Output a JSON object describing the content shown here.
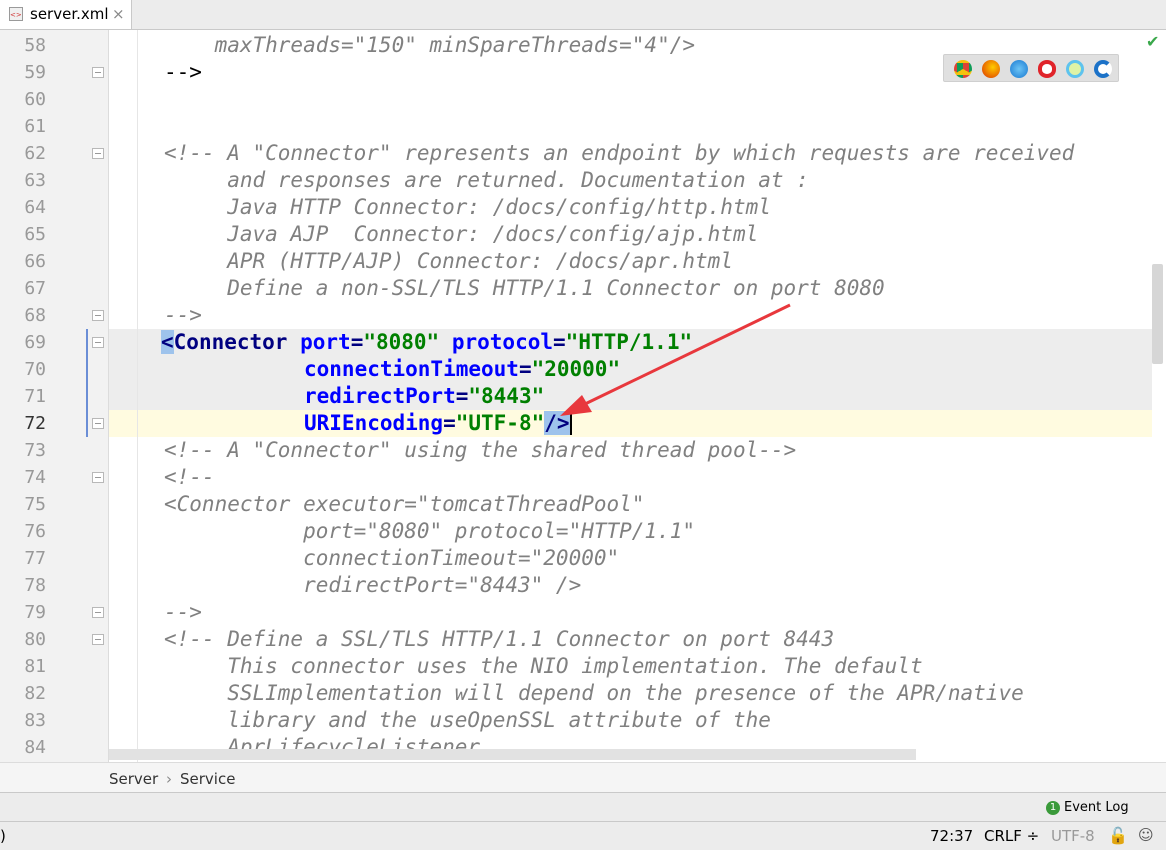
{
  "tab": {
    "filename": "server.xml",
    "close_glyph": "×"
  },
  "gutter": {
    "line_numbers": [
      "58",
      "59",
      "60",
      "61",
      "62",
      "63",
      "64",
      "65",
      "66",
      "67",
      "68",
      "69",
      "70",
      "71",
      "72",
      "73",
      "74",
      "75",
      "76",
      "77",
      "78",
      "79",
      "80",
      "81",
      "82",
      "83",
      "84"
    ]
  },
  "code": {
    "l58": "    maxThreads=\"150\" minSpareThreads=\"4\"/>",
    "l59": "-->",
    "l62": "<!-- A \"Connector\" represents an endpoint by which requests are received",
    "l63": "     and responses are returned. Documentation at :",
    "l64": "     Java HTTP Connector: /docs/config/http.html",
    "l65": "     Java AJP  Connector: /docs/config/ajp.html",
    "l66": "     APR (HTTP/AJP) Connector: /docs/apr.html",
    "l67": "     Define a non-SSL/TLS HTTP/1.1 Connector on port 8080",
    "l68": "-->",
    "l69": {
      "open": "<",
      "tag": "Connector",
      "a1": "port",
      "v1": "\"8080\"",
      "a2": "protocol",
      "v2": "\"HTTP/1.1\""
    },
    "l70": {
      "attr": "connectionTimeout",
      "val": "\"20000\""
    },
    "l71": {
      "attr": "redirectPort",
      "val": "\"8443\""
    },
    "l72": {
      "attr": "URIEncoding",
      "val": "\"UTF-8\"",
      "close": "/>"
    },
    "l73": "<!-- A \"Connector\" using the shared thread pool-->",
    "l74": "<!--",
    "l75": "<Connector executor=\"tomcatThreadPool\"",
    "l76": "           port=\"8080\" protocol=\"HTTP/1.1\"",
    "l77": "           connectionTimeout=\"20000\"",
    "l78": "           redirectPort=\"8443\" />",
    "l79": "-->",
    "l80": "<!-- Define a SSL/TLS HTTP/1.1 Connector on port 8443",
    "l81": "     This connector uses the NIO implementation. The default",
    "l82": "     SSLImplementation will depend on the presence of the APR/native",
    "l83": "     library and the useOpenSSL attribute of the",
    "l84": "     AprLifecycleListener."
  },
  "browser_icons": [
    "chrome-icon",
    "firefox-icon",
    "safari-icon",
    "opera-icon",
    "ie-icon",
    "edge-icon"
  ],
  "breadcrumbs": {
    "item1": "Server",
    "separator": "›",
    "item2": "Service"
  },
  "event_log": {
    "badge": "1",
    "label": "Event Log"
  },
  "status": {
    "left": ")",
    "position": "72:37",
    "line_sep": "CRLF ÷",
    "encoding": "UTF-8"
  },
  "colors": {
    "tag": "#000080",
    "attr": "#0000ff",
    "value": "#008000",
    "comment": "#808080",
    "caret_row": "#fffbe0",
    "arrow": "#e8383d"
  }
}
